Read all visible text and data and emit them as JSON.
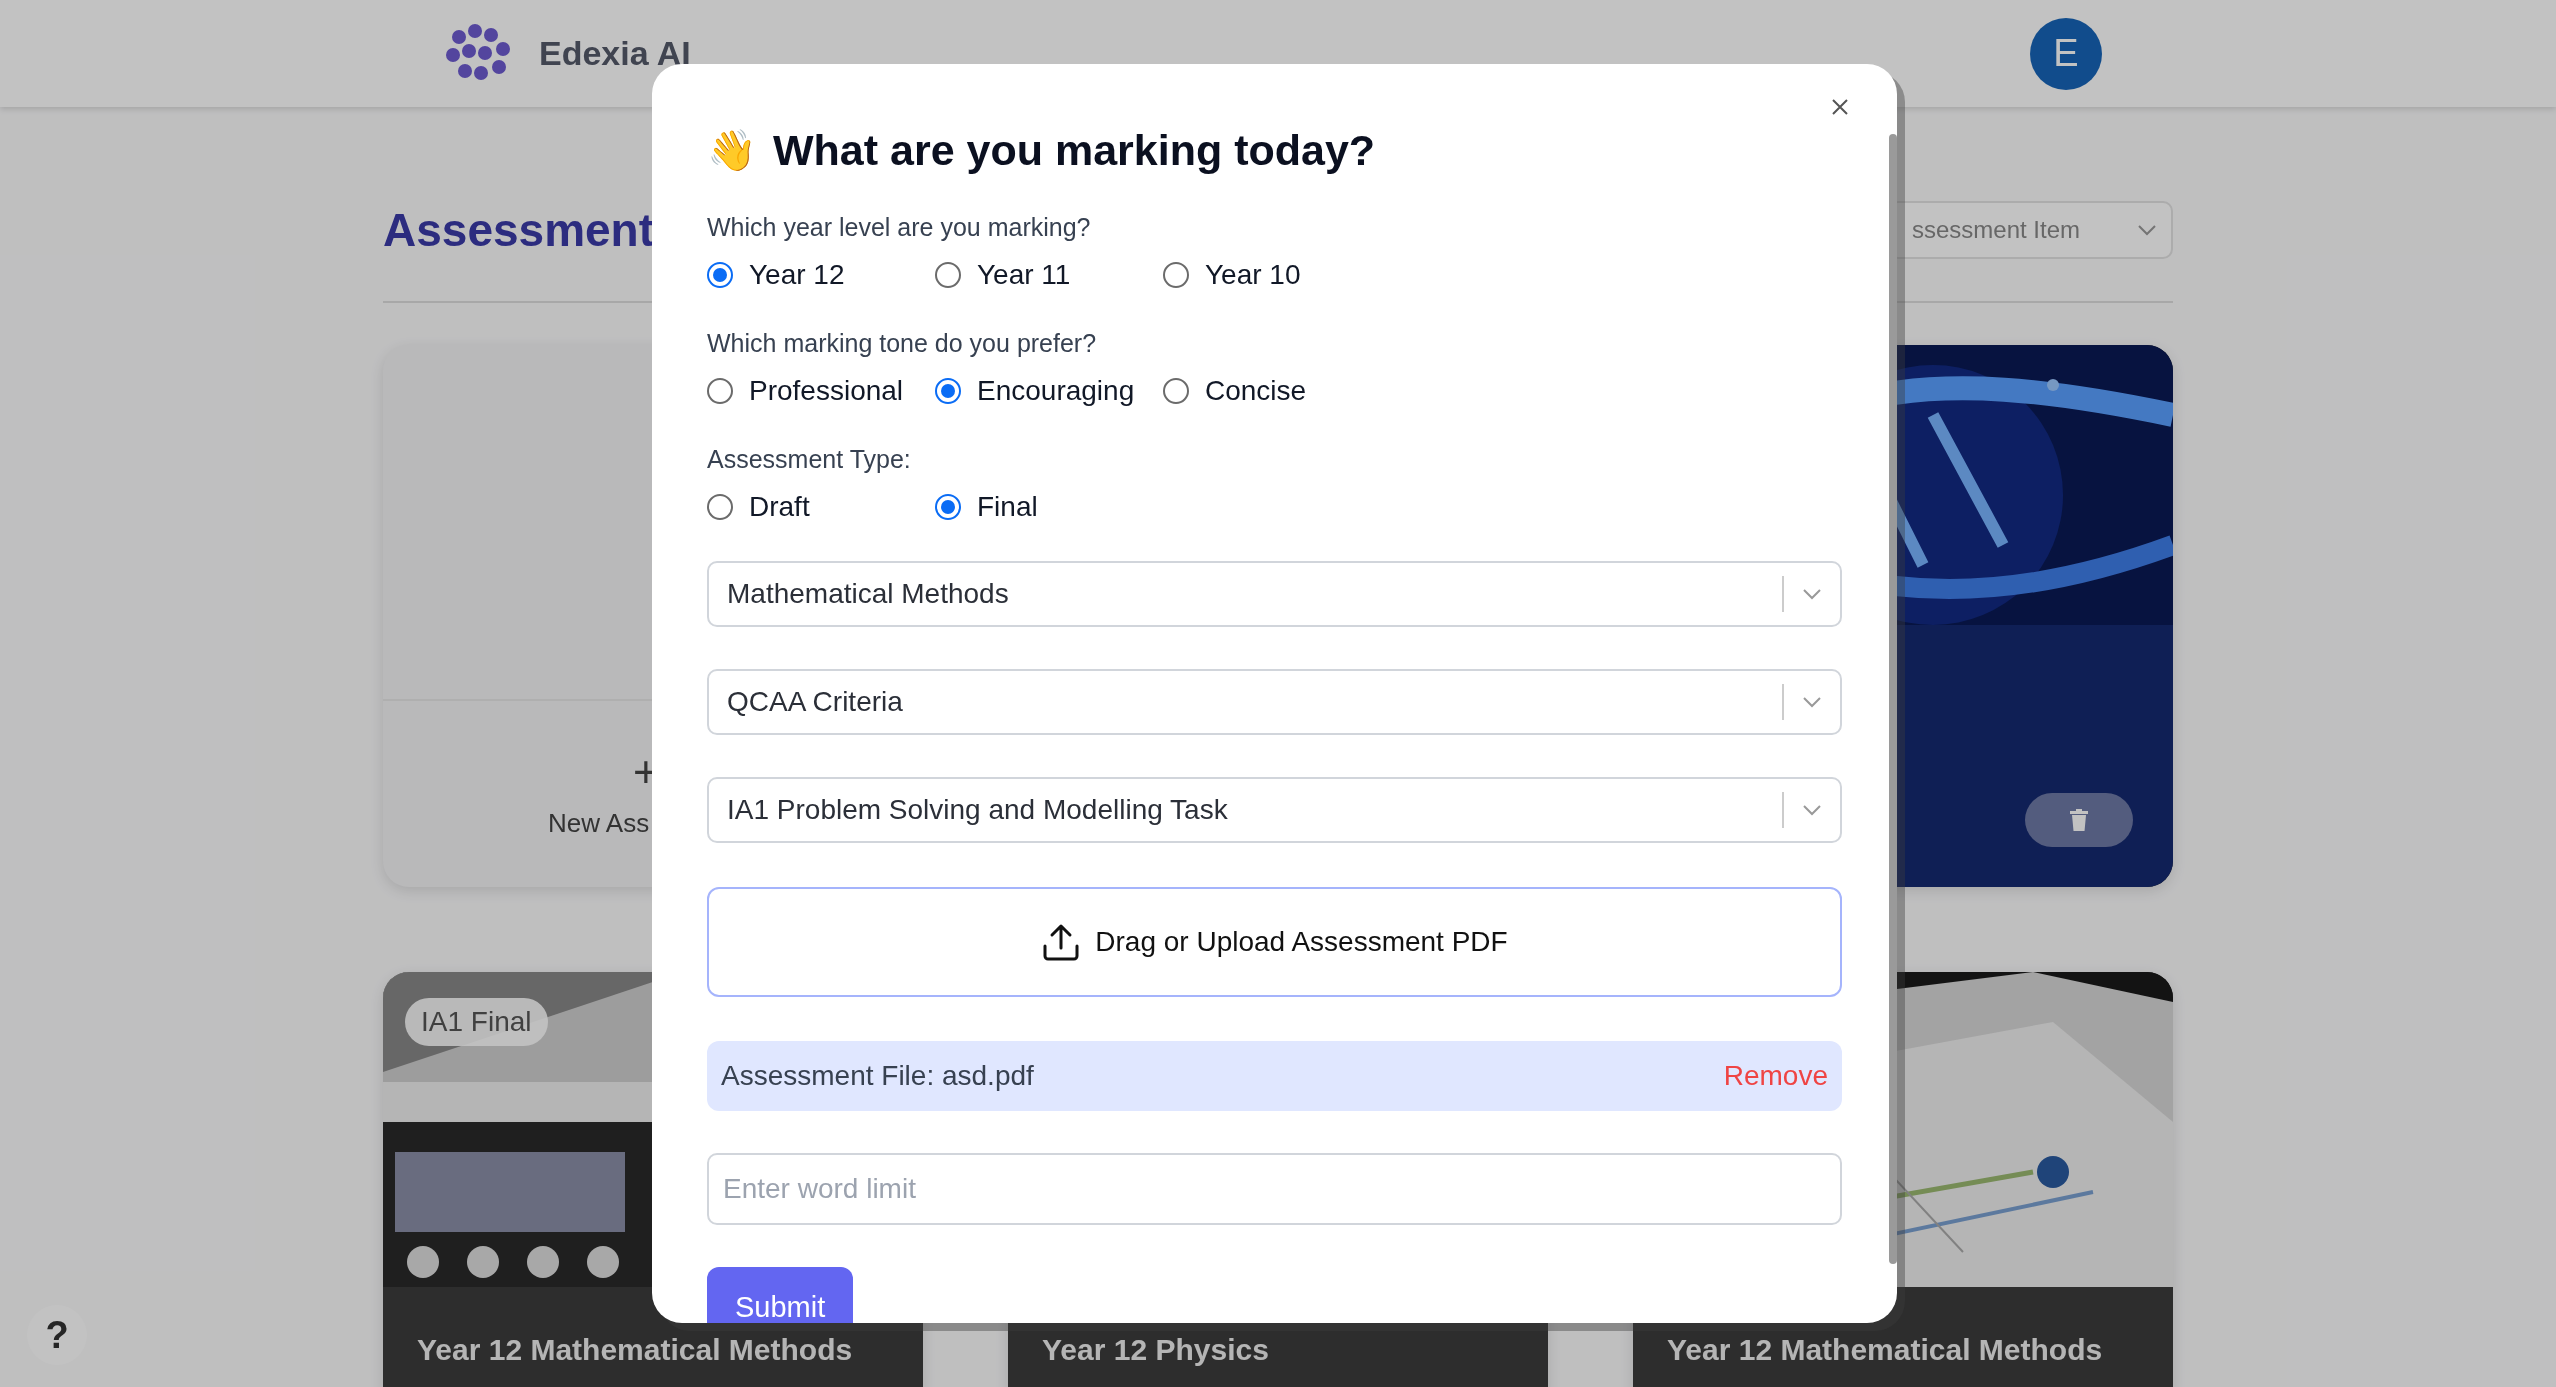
{
  "header": {
    "brand": "Edexia AI",
    "avatar": "E"
  },
  "page": {
    "title": "Assessment",
    "filter": "ssessment Item"
  },
  "new_card": {
    "icon": "+",
    "label": "New Ass"
  },
  "cards": [
    {
      "badge": "IA1 Final",
      "title": "Year 12 Mathematical Methods",
      "kind": "picture"
    },
    {
      "title": "Year 12 Physics"
    },
    {
      "title": "Year 12 Mathematical Methods",
      "kind": "picture"
    }
  ],
  "help": "?",
  "modal": {
    "emoji": "👋",
    "title": "What are you marking today?",
    "questions": [
      {
        "label": "Which year level are you marking?",
        "options": [
          {
            "label": "Year 12",
            "selected": true
          },
          {
            "label": "Year 11",
            "selected": false
          },
          {
            "label": "Year 10",
            "selected": false
          }
        ]
      },
      {
        "label": "Which marking tone do you prefer?",
        "options": [
          {
            "label": "Professional",
            "selected": false
          },
          {
            "label": "Encouraging",
            "selected": true
          },
          {
            "label": "Concise",
            "selected": false
          }
        ]
      },
      {
        "label": "Assessment Type:",
        "options": [
          {
            "label": "Draft",
            "selected": false
          },
          {
            "label": "Final",
            "selected": true
          }
        ]
      }
    ],
    "selects": [
      {
        "value": "Mathematical Methods"
      },
      {
        "value": "QCAA Criteria"
      },
      {
        "value": "IA1 Problem Solving and Modelling Task"
      }
    ],
    "upload": "Drag or Upload Assessment PDF",
    "file": {
      "label": "Assessment File: asd.pdf",
      "action": "Remove"
    },
    "word_limit": {
      "placeholder": "Enter word limit"
    },
    "submit": "Submit"
  }
}
